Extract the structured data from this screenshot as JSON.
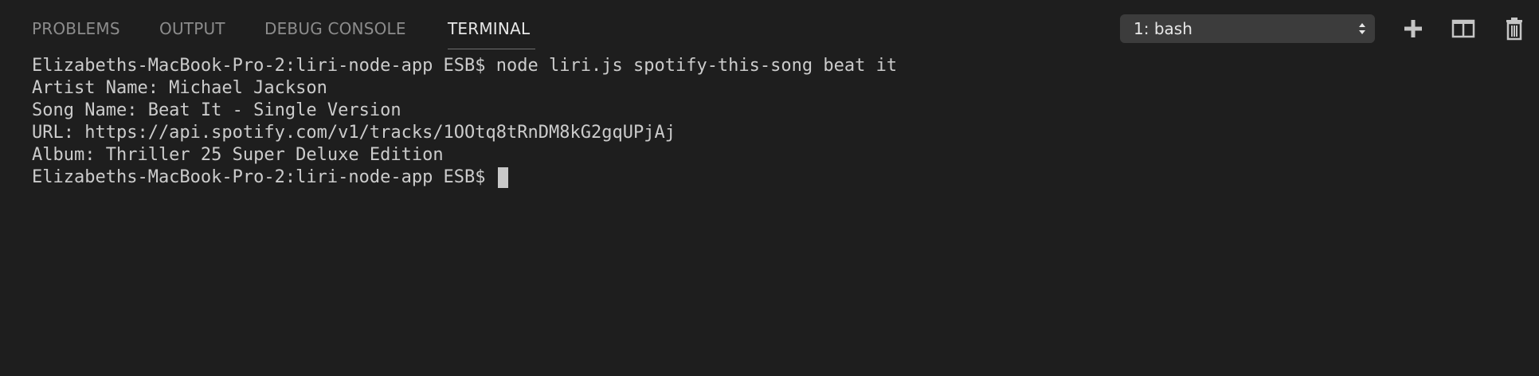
{
  "tabs": [
    {
      "label": "PROBLEMS",
      "active": false
    },
    {
      "label": "OUTPUT",
      "active": false
    },
    {
      "label": "DEBUG CONSOLE",
      "active": false
    },
    {
      "label": "TERMINAL",
      "active": true
    }
  ],
  "terminal_selector": {
    "selected": "1: bash"
  },
  "toolbar": {
    "icons": [
      "plus-icon",
      "split-icon",
      "trash-icon"
    ]
  },
  "terminal": {
    "lines": [
      "Elizabeths-MacBook-Pro-2:liri-node-app ESB$ node liri.js spotify-this-song beat it",
      "Artist Name: Michael Jackson",
      "Song Name: Beat It - Single Version",
      "URL: https://api.spotify.com/v1/tracks/1OOtq8tRnDM8kG2gqUPjAj",
      "Album: Thriller 25 Super Deluxe Edition"
    ],
    "prompt": "Elizabeths-MacBook-Pro-2:liri-node-app ESB$ "
  },
  "colors": {
    "background": "#1e1e1e",
    "tab_inactive": "#8c8c8c",
    "tab_active": "#e7e7e7",
    "terminal_text": "#cccccc",
    "select_bg": "#3c3c3c"
  }
}
